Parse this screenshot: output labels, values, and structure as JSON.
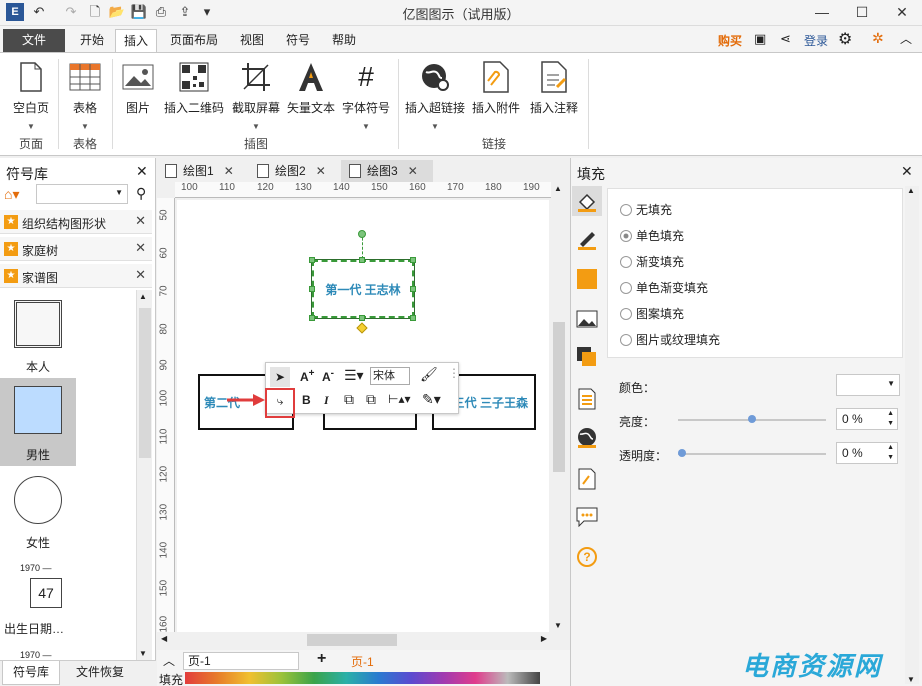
{
  "app": {
    "title": "亿图图示（试用版）",
    "minimize": "—",
    "maximize": "☐",
    "close": "✕"
  },
  "menu": {
    "tabs": [
      "文件",
      "开始",
      "插入",
      "页面布局",
      "视图",
      "符号",
      "帮助"
    ],
    "active": "插入",
    "right": {
      "buy": "购买",
      "login": "登录"
    }
  },
  "ribbon": {
    "buttons": [
      "空白页",
      "表格",
      "图片",
      "插入二维码",
      "截取屏幕",
      "矢量文本",
      "字体符号",
      "插入超链接",
      "插入附件",
      "插入注释"
    ],
    "groups": [
      "页面",
      "表格",
      "插图",
      "链接"
    ]
  },
  "symbols": {
    "title": "符号库",
    "libraries": [
      "组织结构图形状",
      "家庭树",
      "家谱图"
    ],
    "shapes": [
      "本人",
      "男性",
      "女性",
      "出生日期…"
    ],
    "date_label": "1970 —",
    "date_label2": "1970 —",
    "date_value": "47",
    "bottom_tabs": [
      "符号库",
      "文件恢复"
    ]
  },
  "docs": {
    "tabs": [
      "绘图1",
      "绘图2",
      "绘图3"
    ],
    "active": "绘图3",
    "ruler_h": [
      "100",
      "110",
      "120",
      "130",
      "140",
      "150",
      "160",
      "170",
      "180",
      "190"
    ],
    "ruler_v": [
      "50",
      "60",
      "70",
      "80",
      "90",
      "100",
      "110",
      "120",
      "130",
      "140",
      "150",
      "160"
    ],
    "nodes": [
      "第一代 王志林",
      "第二代",
      "三代 三子王森"
    ],
    "toolbar_font": "宋体",
    "page_select": "页-1",
    "page_tab": "页-1",
    "fill_label": "填充"
  },
  "fill_panel": {
    "title": "填充",
    "options": [
      "无填充",
      "单色填充",
      "渐变填充",
      "单色渐变填充",
      "图案填充",
      "图片或纹理填充"
    ],
    "selected": "单色填充",
    "color_label": "颜色：",
    "brightness_label": "亮度：",
    "brightness_value": "0 %",
    "brightness": 0.5,
    "transparency_label": "透明度：",
    "transparency_value": "0 %",
    "transparency": 0.0
  },
  "watermark": "电商资源网",
  "colors": {
    "accent": "#2e8ab8",
    "orange": "#f39c12",
    "selected": "#3a9a3a",
    "red": "#e03c3c"
  }
}
